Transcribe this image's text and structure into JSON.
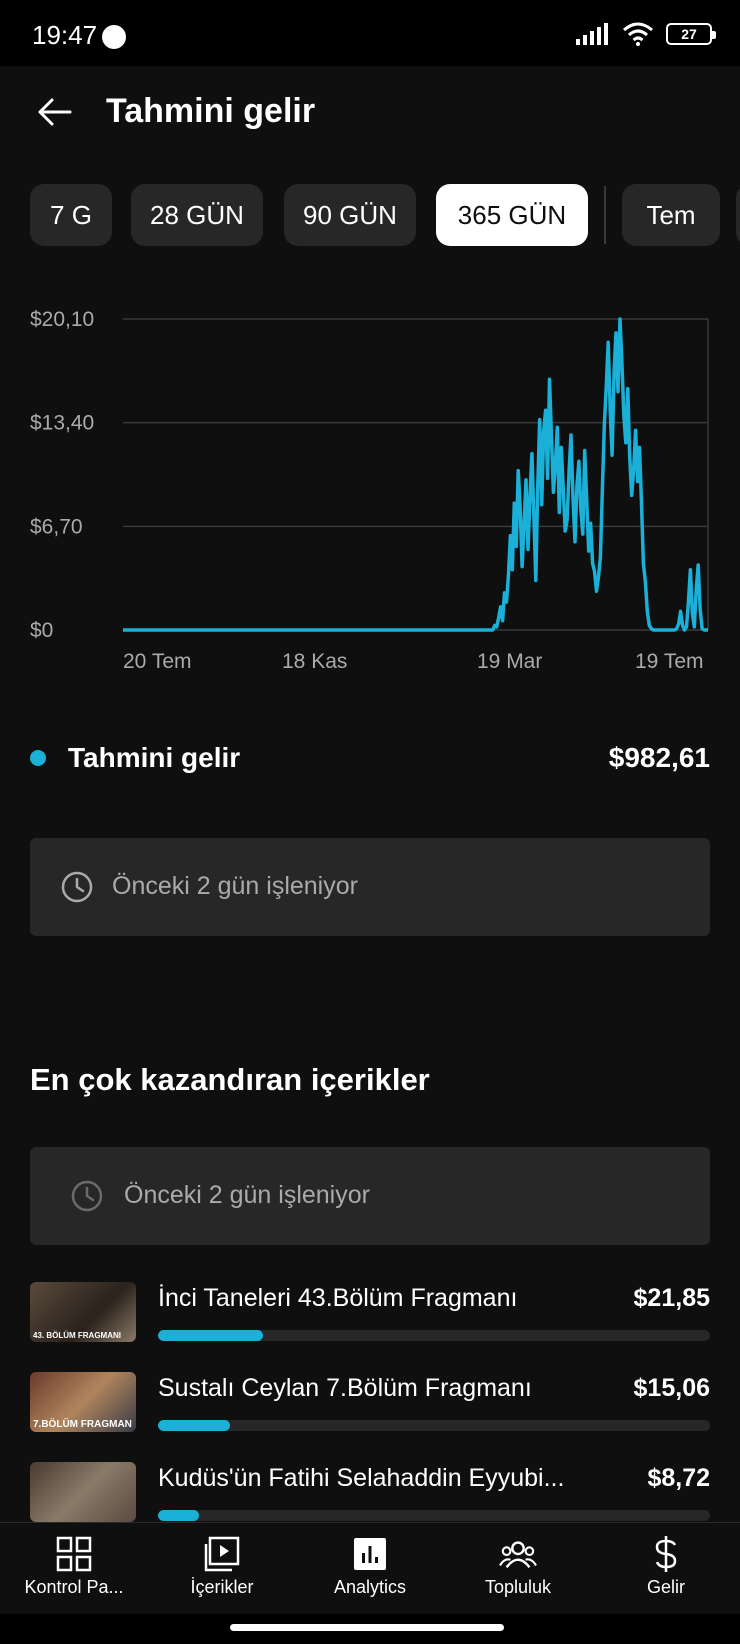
{
  "status_bar": {
    "time": "19:47",
    "battery": "27"
  },
  "header": {
    "title": "Tahmini gelir"
  },
  "period_chips": [
    {
      "label": "7 G",
      "selected": false
    },
    {
      "label": "28 GÜN",
      "selected": false
    },
    {
      "label": "90 GÜN",
      "selected": false
    },
    {
      "label": "365 GÜN",
      "selected": true
    },
    {
      "label": "Tem",
      "selected": false
    }
  ],
  "chart_data": {
    "type": "line",
    "y_ticks": [
      "$20,10",
      "$13,40",
      "$6,70",
      "$0"
    ],
    "x_ticks": [
      "20 Tem",
      "18 Kas",
      "19 Mar",
      "19 Tem"
    ],
    "ylim": [
      0,
      20.1
    ],
    "color": "#1ab0d8",
    "series": [
      {
        "values": [
          0,
          0,
          0,
          0,
          0,
          0,
          0,
          0,
          0,
          0,
          0,
          0,
          0,
          0,
          0,
          0,
          0,
          0,
          0,
          0,
          0,
          0,
          0,
          0,
          0,
          0,
          0,
          0,
          0,
          0,
          0,
          0,
          0,
          0,
          0,
          0,
          0,
          0,
          0,
          0,
          0,
          0,
          0,
          0,
          0,
          0,
          0,
          0,
          0,
          0,
          0,
          0,
          0,
          0,
          0,
          0,
          0,
          0,
          0,
          0,
          0,
          0,
          0,
          0,
          0,
          0,
          0,
          0,
          0,
          0,
          0,
          0,
          0,
          0,
          0,
          0,
          0,
          0,
          0,
          0,
          0,
          0,
          0,
          0,
          0,
          0,
          0,
          0,
          0,
          0,
          0,
          0,
          0,
          0,
          0,
          0,
          0,
          0,
          0,
          0,
          0,
          0,
          0,
          0,
          0,
          0,
          0,
          0,
          0,
          0,
          0,
          0,
          0,
          0,
          0,
          0,
          0,
          0,
          0,
          0,
          0,
          0,
          0,
          0,
          0,
          0,
          0,
          0,
          0,
          0,
          0,
          0,
          0,
          0,
          0,
          0,
          0,
          0,
          0,
          0,
          0,
          0,
          0,
          0,
          0,
          0,
          0,
          0,
          0,
          0,
          0,
          0,
          0,
          0,
          0,
          0,
          0,
          0,
          0,
          0,
          0,
          0,
          0,
          0,
          0,
          0,
          0,
          0,
          0,
          0,
          0,
          0,
          0,
          0,
          0,
          0,
          0,
          0,
          0,
          0,
          0,
          0,
          0,
          0,
          0,
          0,
          0,
          0,
          0,
          0,
          0.3,
          0.2,
          0.8,
          1.5,
          0.6,
          2.4,
          1.8,
          3.5,
          6.1,
          3.9,
          8.2,
          5.4,
          10.3,
          7.9,
          4.1,
          6.8,
          9.7,
          5.2,
          8.6,
          11.4,
          7.3,
          3.2,
          9.4,
          13.6,
          8.1,
          12.9,
          14.2,
          9.8,
          16.2,
          12.4,
          8.9,
          10.7,
          13.1,
          7.6,
          11.8,
          9.2,
          6.4,
          7.1,
          10.3,
          12.6,
          8.5,
          5.7,
          9.3,
          10.9,
          7.8,
          6.2,
          11.6,
          8.4,
          5.1,
          6.9,
          4.3,
          3.8,
          2.5,
          3.4,
          4.7,
          8.9,
          13.2,
          15.8,
          18.6,
          14.2,
          11.3,
          16.7,
          19.2,
          15.4,
          20.1,
          17.3,
          13.8,
          12.1,
          15.6,
          11.2,
          8.7,
          10.4,
          12.9,
          9.6,
          11.8,
          8.2,
          4.3,
          3.1,
          1.2,
          0.3,
          0.1,
          0,
          0,
          0,
          0,
          0,
          0,
          0,
          0,
          0,
          0,
          0,
          0,
          0.1,
          0.4,
          1.2,
          0.3,
          0,
          0.2,
          1.8,
          3.9,
          1.1,
          0.2,
          2.7,
          4.2,
          1.3,
          0.1,
          0,
          0,
          0
        ]
      }
    ]
  },
  "summary": {
    "label": "Tahmini gelir",
    "value": "$982,61"
  },
  "processing_notice": {
    "text": "Önceki 2 gün işleniyor"
  },
  "top_content": {
    "title": "En çok kazandıran içerikler",
    "notice": "Önceki 2 gün işleniyor",
    "items": [
      {
        "title": "İnci Taneleri 43.Bölüm Fragmanı",
        "value": "$21,85",
        "share": 0.19,
        "thumb_caption": "43. BÖLÜM FRAGMANI"
      },
      {
        "title": "Sustalı Ceylan 7.Bölüm Fragmanı",
        "value": "$15,06",
        "share": 0.13,
        "thumb_caption": "7.BÖLÜM FRAGMAN"
      },
      {
        "title": "Kudüs'ün Fatihi Selahaddin Eyyubi...",
        "value": "$8,72",
        "share": 0.075,
        "thumb_caption": ""
      }
    ]
  },
  "bottom_nav": [
    {
      "label": "Kontrol Pa...",
      "icon": "dashboard-icon"
    },
    {
      "label": "İçerikler",
      "icon": "content-icon"
    },
    {
      "label": "Analytics",
      "icon": "analytics-icon",
      "active": true
    },
    {
      "label": "Topluluk",
      "icon": "community-icon"
    },
    {
      "label": "Gelir",
      "icon": "earn-icon"
    }
  ]
}
